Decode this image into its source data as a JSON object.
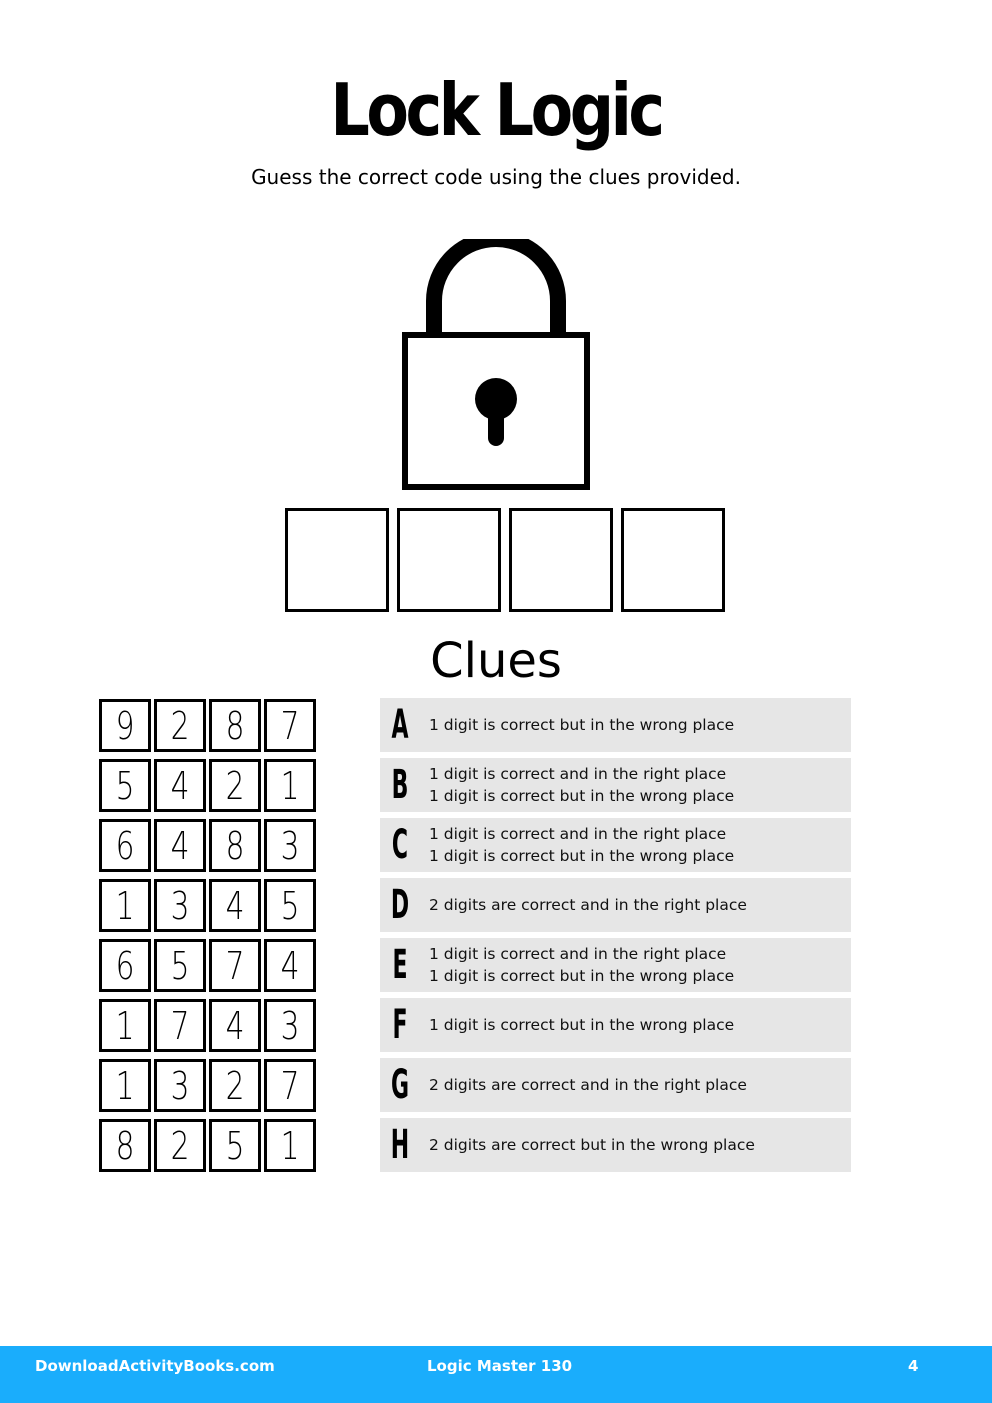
{
  "header": {
    "title": "Lock Logic",
    "subtitle": "Guess the correct code using the clues provided."
  },
  "padlock": {
    "icon": "padlock-icon"
  },
  "answer": {
    "slots": [
      "",
      "",
      "",
      ""
    ]
  },
  "clues_heading": "Clues",
  "clues": [
    {
      "letter": "A",
      "digits": [
        "9",
        "2",
        "8",
        "7"
      ],
      "lines": [
        "1 digit is correct but in the wrong place"
      ]
    },
    {
      "letter": "B",
      "digits": [
        "5",
        "4",
        "2",
        "1"
      ],
      "lines": [
        "1 digit is correct and in the right place",
        "1 digit is correct but in the wrong place"
      ]
    },
    {
      "letter": "C",
      "digits": [
        "6",
        "4",
        "8",
        "3"
      ],
      "lines": [
        "1 digit is correct and in the right place",
        "1 digit is correct but in the wrong place"
      ]
    },
    {
      "letter": "D",
      "digits": [
        "1",
        "3",
        "4",
        "5"
      ],
      "lines": [
        "2 digits are correct and in the right place"
      ]
    },
    {
      "letter": "E",
      "digits": [
        "6",
        "5",
        "7",
        "4"
      ],
      "lines": [
        "1 digit is correct and in the right place",
        "1 digit is correct but in the wrong place"
      ]
    },
    {
      "letter": "F",
      "digits": [
        "1",
        "7",
        "4",
        "3"
      ],
      "lines": [
        "1 digit is correct but in the wrong place"
      ]
    },
    {
      "letter": "G",
      "digits": [
        "1",
        "3",
        "2",
        "7"
      ],
      "lines": [
        "2 digits are correct and in the right place"
      ]
    },
    {
      "letter": "H",
      "digits": [
        "8",
        "2",
        "5",
        "1"
      ],
      "lines": [
        "2 digits are correct but in the wrong place"
      ]
    }
  ],
  "footer": {
    "site": "DownloadActivityBooks.com",
    "book": "Logic Master 130",
    "page": "4",
    "color": "#1aadfc"
  }
}
